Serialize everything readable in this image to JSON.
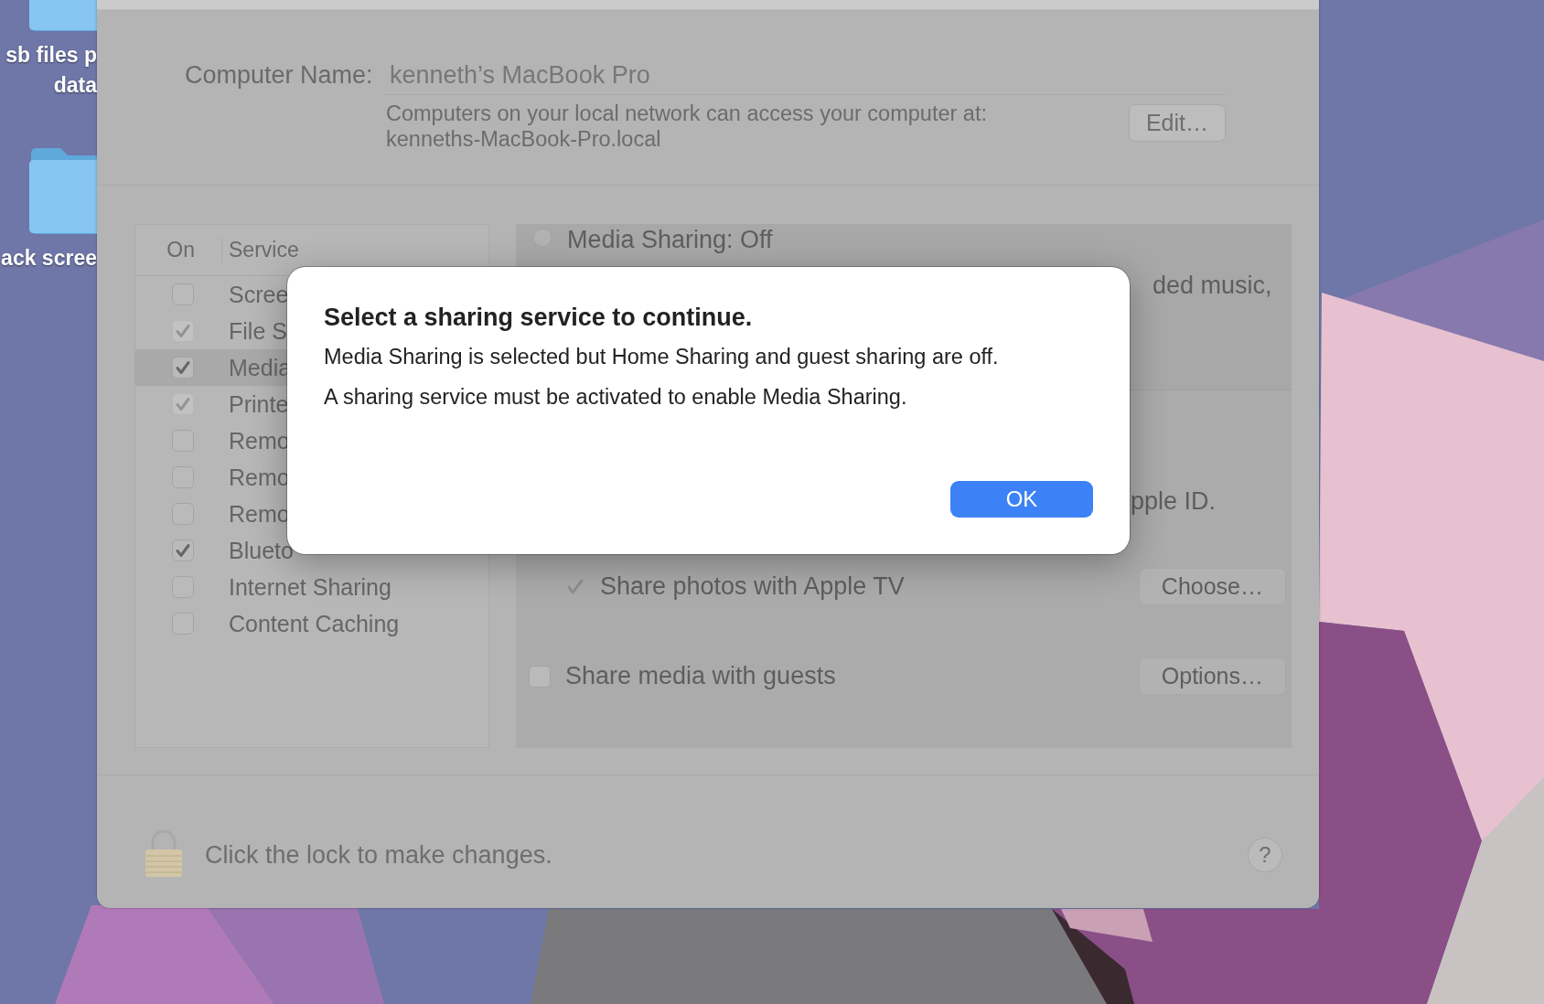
{
  "desktop_icons": [
    {
      "label": [
        "sb files p",
        "data"
      ]
    },
    {
      "label": [
        "ack scree"
      ]
    }
  ],
  "window": {
    "computer_name": {
      "label": "Computer Name:",
      "value": "kenneth’s MacBook Pro",
      "note": [
        "Computers on your local network can access your computer at:",
        "kenneths-MacBook-Pro.local"
      ],
      "edit_button": "Edit…"
    },
    "services": {
      "columns": [
        "On",
        "Service"
      ],
      "rows": [
        {
          "name": "Scree",
          "checked": false,
          "dimmed": false,
          "selected": false
        },
        {
          "name": "File S",
          "checked": true,
          "dimmed": true,
          "selected": false
        },
        {
          "name": "Media",
          "checked": true,
          "dimmed": false,
          "selected": true
        },
        {
          "name": "Printe",
          "checked": true,
          "dimmed": true,
          "selected": false
        },
        {
          "name": "Remo",
          "checked": false,
          "dimmed": false,
          "selected": false
        },
        {
          "name": "Remo",
          "checked": false,
          "dimmed": false,
          "selected": false
        },
        {
          "name": "Remo",
          "checked": false,
          "dimmed": false,
          "selected": false
        },
        {
          "name": "Blueto",
          "checked": true,
          "dimmed": false,
          "selected": false
        },
        {
          "name": "Internet Sharing",
          "checked": false,
          "dimmed": false,
          "selected": false
        },
        {
          "name": "Content Caching",
          "checked": false,
          "dimmed": false,
          "selected": false
        }
      ]
    },
    "media_panel": {
      "status": "Media Sharing: Off",
      "on": false,
      "description_fragment": "ded music,",
      "note_fragment": "pple ID.",
      "options": [
        {
          "label": "Share photos with Apple TV",
          "checked": true,
          "kind": "tick",
          "button": "Choose…"
        },
        {
          "label": "Share media with guests",
          "checked": false,
          "kind": "checkbox",
          "button": "Options…"
        }
      ]
    },
    "footer": {
      "lock_text": "Click the lock to make changes.",
      "help": "?"
    }
  },
  "dialog": {
    "title": "Select a sharing service to continue.",
    "messages": [
      "Media Sharing is selected but Home Sharing and guest sharing are off.",
      "A sharing service must be activated to enable Media Sharing."
    ],
    "button": "OK"
  }
}
